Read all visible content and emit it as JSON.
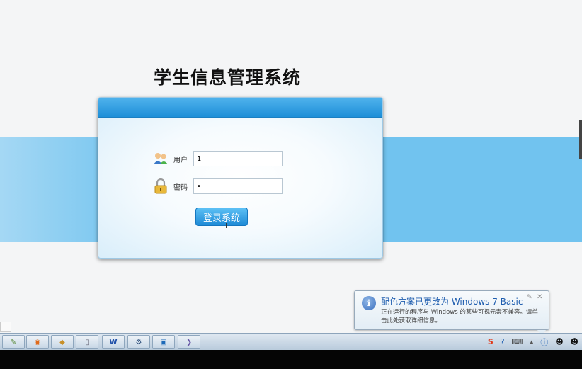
{
  "page": {
    "title": "学生信息管理系统"
  },
  "form": {
    "username_label": "用户",
    "username_value": "1",
    "password_label": "密码",
    "password_value": "1",
    "submit_label": "登录系统"
  },
  "notification": {
    "title": "配色方案已更改为 Windows 7 Basic",
    "message": "正在运行的程序与 Windows 的某些可视元素不兼容。请单击此处获取详细信息。",
    "pin_glyph": "✎",
    "close_glyph": "✕",
    "info_glyph": "i"
  },
  "taskbar": {
    "buttons": [
      {
        "icon": "notepad-icon",
        "glyph": "✎"
      },
      {
        "icon": "firefox-icon",
        "glyph": "◉"
      },
      {
        "icon": "eraser-icon",
        "glyph": "◆"
      },
      {
        "icon": "window-icon",
        "glyph": "▯"
      },
      {
        "icon": "word-icon",
        "glyph": "W"
      },
      {
        "icon": "app-icon",
        "glyph": "⚙"
      },
      {
        "icon": "folder-icon",
        "glyph": "▣"
      },
      {
        "icon": "media-icon",
        "glyph": "❯"
      }
    ],
    "tray": [
      {
        "icon": "sogou-input-icon",
        "glyph": "S"
      },
      {
        "icon": "help-icon",
        "glyph": "?"
      },
      {
        "icon": "keyboard-icon",
        "glyph": "⌨"
      },
      {
        "icon": "arrow-up-icon",
        "glyph": "▲"
      },
      {
        "icon": "info-icon",
        "glyph": "ⓘ"
      },
      {
        "icon": "qq-icon-1",
        "glyph": "☻"
      },
      {
        "icon": "qq-icon-2",
        "glyph": "☻"
      }
    ]
  },
  "colors": {
    "band": "#71c3ef",
    "header": "#1e8fd8",
    "button": "#1e8ad6"
  }
}
